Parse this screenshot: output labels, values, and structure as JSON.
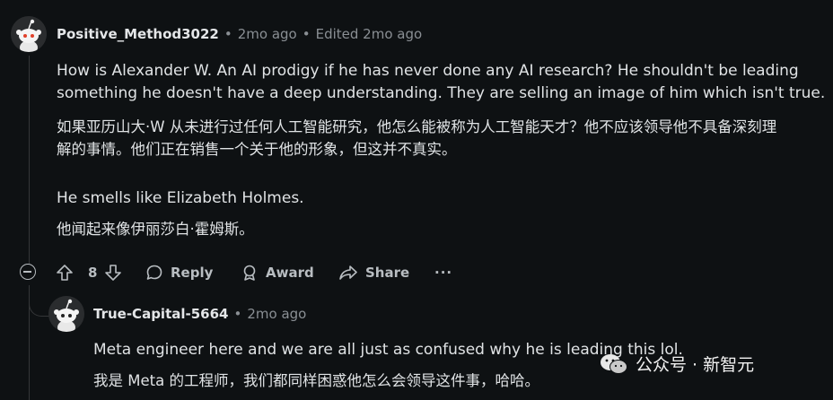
{
  "comment": {
    "username": "Positive_Method3022",
    "time": "2mo ago",
    "edited": "Edited 2mo ago",
    "lines": [
      "How is Alexander W. An AI prodigy if he has never done any AI research? He shouldn't be leading",
      "something he doesn't have a deep understanding. They are selling an image of him which isn't true.",
      "如果亚历山大·W 从未进行过任何人工智能研究，他怎么能被称为人工智能天才？他不应该领导他不具备深刻理",
      "解的事情。他们正在销售一个关于他的形象，但这并不真实。",
      "He smells like Elizabeth Holmes.",
      "他闻起来像伊丽莎白·霍姆斯。"
    ],
    "votes": "8",
    "reply_label": "Reply",
    "award_label": "Award",
    "share_label": "Share",
    "more_label": "···"
  },
  "reply": {
    "username": "True-Capital-5664",
    "time": "2mo ago",
    "lines": [
      "Meta engineer here and we are all just as confused why he is leading this lol.",
      "我是 Meta 的工程师，我们都同样困惑他怎么会领导这件事，哈哈。"
    ]
  },
  "watermark": {
    "text": "公众号 · 新智元",
    "icon": "wechat-icon"
  }
}
